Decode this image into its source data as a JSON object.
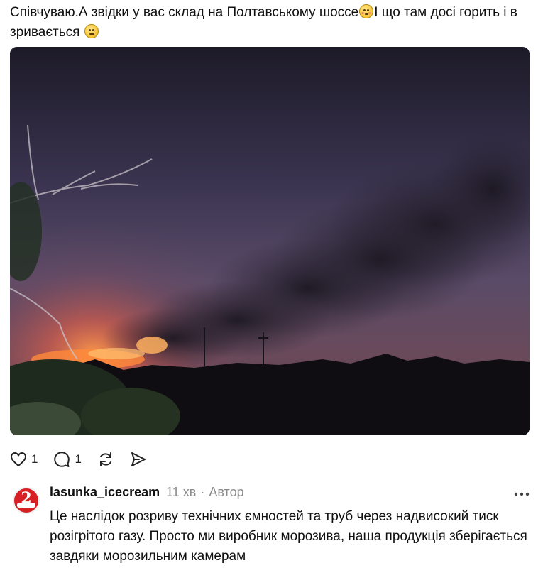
{
  "post": {
    "text_part1": "Співчуваю.А звідки у вас склад на Полтавському шоссе",
    "text_part2": "І що там досі горить і в зривається "
  },
  "actions": {
    "like_count": "1",
    "comment_count": "1"
  },
  "reply": {
    "username": "lasunka_icecream",
    "time": "11 хв",
    "separator": "·",
    "role": "Автор",
    "text": "Це наслідок розриву технічних ємностей та труб через надвисокий тиск розігрітого газу. Просто ми виробник морозива, наша продукція зберігається завдяки морозильним камерам"
  },
  "icons": [
    "flushed-emoji-icon",
    "neutral-emoji-icon",
    "heart-icon",
    "comment-icon",
    "repost-icon",
    "share-icon",
    "more-icon"
  ]
}
